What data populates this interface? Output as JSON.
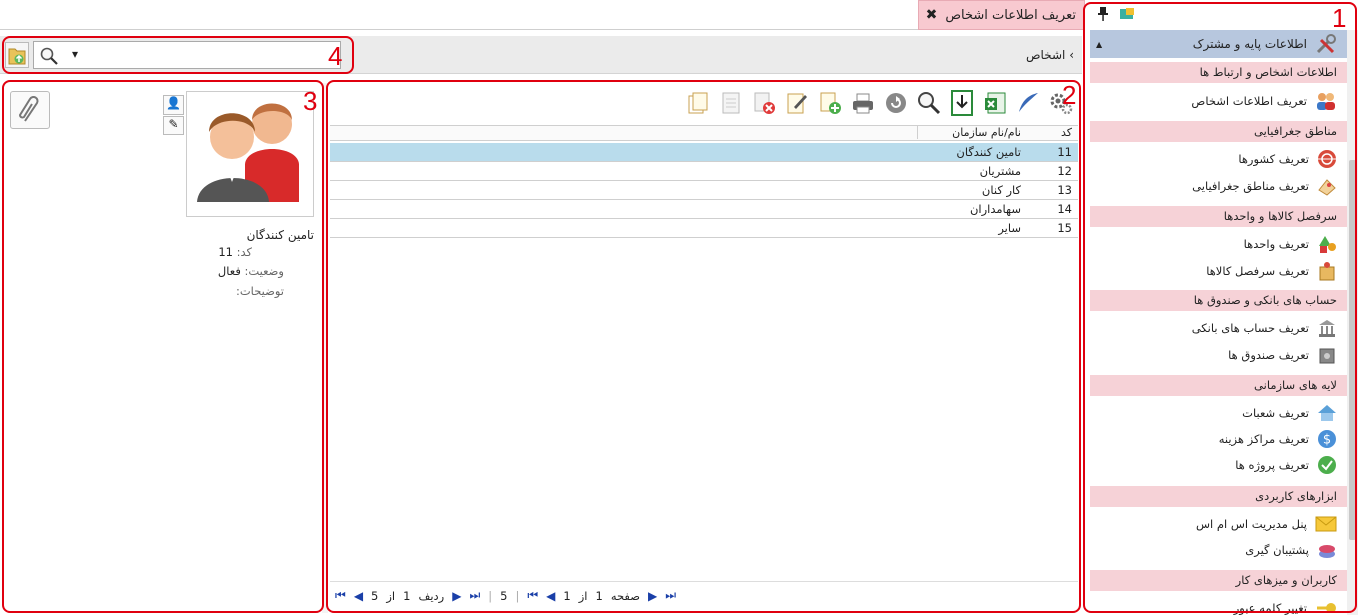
{
  "tab": {
    "title": "تعریف اطلاعات اشخاص",
    "close_glyph": "✖"
  },
  "breadcrumb": {
    "arrow": "›",
    "label": "اشخاص"
  },
  "search": {
    "value": "",
    "dropdown_glyph": "▾"
  },
  "sidebar": {
    "title": "اطلاعات پایه و مشترک",
    "groups": [
      {
        "label": "اطلاعات اشخاص و ارتباط ها",
        "items": [
          {
            "label": "تعریف اطلاعات اشخاص",
            "icon": "people-icon"
          }
        ]
      },
      {
        "label": "مناطق جغرافیایی",
        "items": [
          {
            "label": "تعریف کشورها",
            "icon": "globe-icon"
          },
          {
            "label": "تعریف مناطق جغرافیایی",
            "icon": "map-icon"
          }
        ]
      },
      {
        "label": "سرفصل کالاها و واحدها",
        "items": [
          {
            "label": "تعریف واحدها",
            "icon": "shapes-icon"
          },
          {
            "label": "تعریف سرفصل کالاها",
            "icon": "box-icon"
          }
        ]
      },
      {
        "label": "حساب های بانکی و صندوق ها",
        "items": [
          {
            "label": "تعریف حساب های بانکی",
            "icon": "bank-icon"
          },
          {
            "label": "تعریف صندوق ها",
            "icon": "cashbox-icon"
          }
        ]
      },
      {
        "label": "لایه های سازمانی",
        "items": [
          {
            "label": "تعریف شعبات",
            "icon": "house-icon"
          },
          {
            "label": "تعریف مراکز هزینه",
            "icon": "dollar-icon"
          },
          {
            "label": "تعریف پروژه ها",
            "icon": "project-icon"
          }
        ]
      },
      {
        "label": "ابزارهای کاربردی",
        "items": [
          {
            "label": "پنل مدیریت اس ام اس",
            "icon": "envelope-icon"
          },
          {
            "label": "پشتیبان گیری",
            "icon": "backup-icon"
          }
        ]
      },
      {
        "label": "کاربران و میزهای کار",
        "items": [
          {
            "label": "تغییر کلمه عبور",
            "icon": "key-icon"
          }
        ]
      }
    ]
  },
  "grid": {
    "columns": {
      "code": "کد",
      "name": "نام/نام سازمان"
    },
    "rows": [
      {
        "code": "11",
        "name": "تامین کنندگان"
      },
      {
        "code": "12",
        "name": "مشتریان"
      },
      {
        "code": "13",
        "name": "کار کنان"
      },
      {
        "code": "14",
        "name": "سهامداران"
      },
      {
        "code": "15",
        "name": "سایر"
      }
    ],
    "selected_index": 0
  },
  "pager": {
    "page_label": "صفحه",
    "page_value": "1",
    "of_label": "از",
    "page_total": "1",
    "page_size": "5",
    "row_label": "ردیف",
    "row_value": "1",
    "row_of": "از",
    "row_total": "5"
  },
  "detail": {
    "name": "تامین کنندگان",
    "code_label": "کد:",
    "code_value": "11",
    "status_label": "وضعیت:",
    "status_value": "فعال",
    "desc_label": "توضیحات:",
    "desc_value": ""
  },
  "annotations": [
    "1",
    "2",
    "3",
    "4"
  ],
  "colors": {
    "annotation": "#e0000f",
    "selected_row": "#b9dcec",
    "group_header": "#f6d2d7",
    "sidebar_title": "#b7c7de",
    "tab_bg": "#f8c9d0"
  }
}
